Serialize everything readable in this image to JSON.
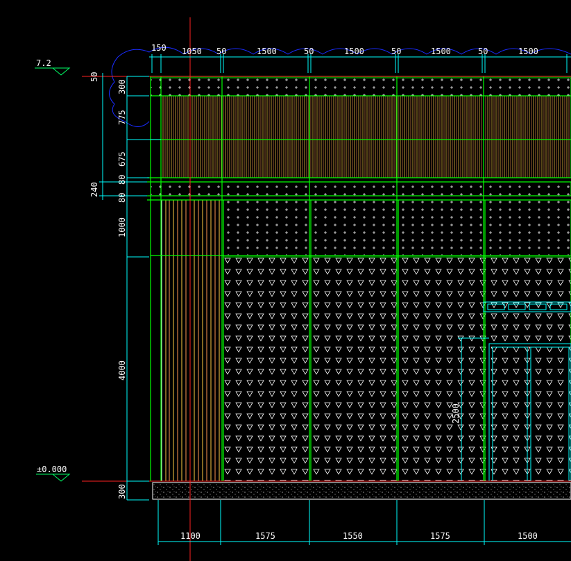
{
  "drawing": {
    "levels": {
      "top": "7.2",
      "ground": "±0.000"
    },
    "top_dims": [
      "150",
      "1050",
      "50",
      "1500",
      "50",
      "1500",
      "50",
      "1500",
      "50",
      "1500"
    ],
    "left_dims": [
      "50",
      "300",
      "775",
      "675",
      "80",
      "240",
      "80",
      "1000",
      "4000",
      "300"
    ],
    "bottom_dims": [
      "1100",
      "1575",
      "1550",
      "1575",
      "1500"
    ],
    "door_dim": "2500",
    "colors": {
      "background": "#000000",
      "dimension": "#00ffff",
      "grid": "#00ff00",
      "axis": "#ff0000",
      "cloud": "#0000ff",
      "slat": "#ffff00",
      "hatch": "#ffffff"
    }
  }
}
